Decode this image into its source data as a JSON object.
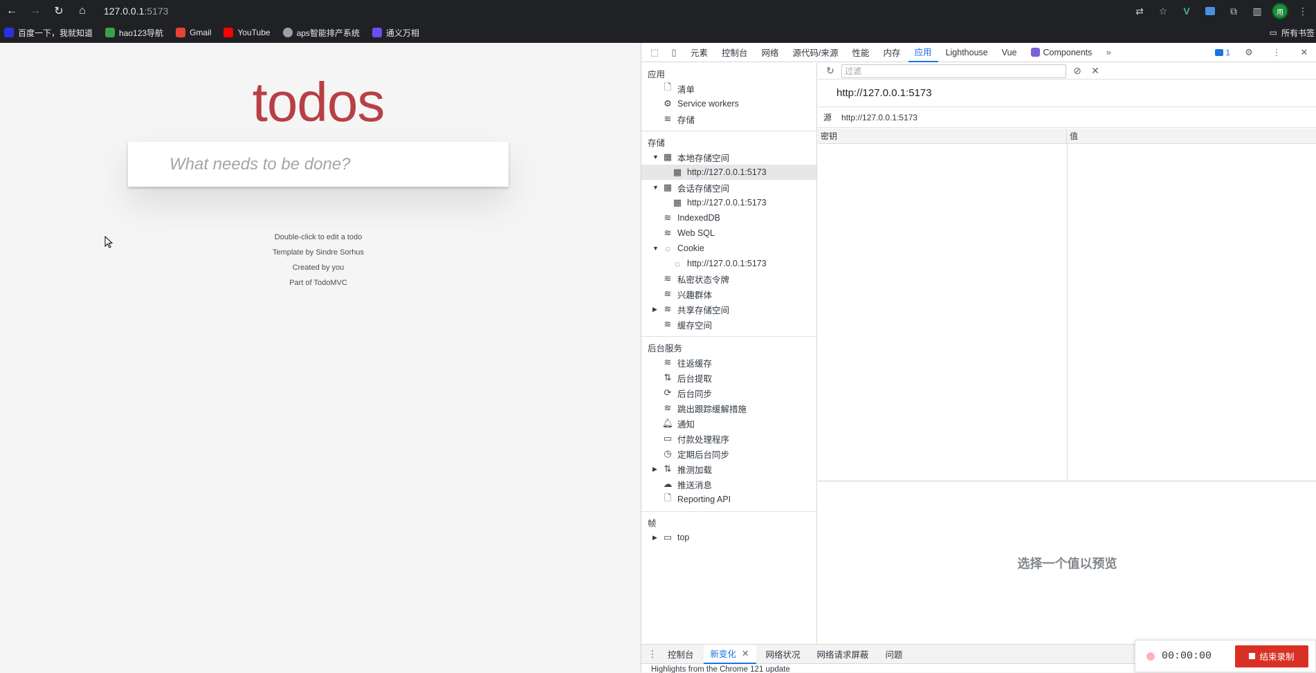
{
  "browser": {
    "url_host": "127.0.0.1",
    "url_port": ":5173",
    "avatar_text": "用",
    "bookmarks": [
      {
        "label": "百度一下，我就知道",
        "color": "#2932e1"
      },
      {
        "label": "hao123导航",
        "color": "#3aa04a"
      },
      {
        "label": "Gmail",
        "color": "#ea4335"
      },
      {
        "label": "YouTube",
        "color": "#ff0000"
      },
      {
        "label": "aps智能排产系统",
        "color": "#9aa0a6"
      },
      {
        "label": "通义万相",
        "color": "#6b4cf5"
      }
    ],
    "all_bookmarks": "所有书签"
  },
  "page": {
    "title": "todos",
    "new_todo_placeholder": "What needs to be done?",
    "info": [
      "Double-click to edit a todo",
      "Template by Sindre Sorhus",
      "Created by you",
      "Part of TodoMVC"
    ]
  },
  "devtools": {
    "tabs": [
      "元素",
      "控制台",
      "网络",
      "源代码/来源",
      "性能",
      "内存",
      "应用",
      "Lighthouse",
      "Vue",
      "Components"
    ],
    "active_tab": "应用",
    "issues_count": "1",
    "sidebar": {
      "app_head": "应用",
      "app_items": [
        "清单",
        "Service workers",
        "存储"
      ],
      "storage_head": "存储",
      "local_storage": "本地存储空间",
      "local_storage_origin": "http://127.0.0.1:5173",
      "session_storage": "会话存储空间",
      "session_storage_origin": "http://127.0.0.1:5173",
      "indexeddb": "IndexedDB",
      "websql": "Web SQL",
      "cookie": "Cookie",
      "cookie_origin": "http://127.0.0.1:5173",
      "private_state_tokens": "私密状态令牌",
      "interest_groups": "兴趣群体",
      "shared_storage": "共享存储空间",
      "cache_storage": "缓存空间",
      "bg_head": "后台服务",
      "bg_items": [
        "往返缓存",
        "后台提取",
        "后台同步",
        "跳出跟踪缓解措施",
        "通知",
        "付款处理程序",
        "定期后台同步",
        "推测加载",
        "推送消息",
        "Reporting API"
      ],
      "frames_head": "帧",
      "frame_top": "top"
    },
    "main": {
      "filter_placeholder": "过滤",
      "origin_title": "http://127.0.0.1:5173",
      "origin_label": "源",
      "origin_value": "http://127.0.0.1:5173",
      "col_key": "密钥",
      "col_value": "值",
      "preview_hint": "选择一个值以预览"
    },
    "drawer": {
      "tabs": [
        "控制台",
        "新变化",
        "网络状况",
        "网络请求屏蔽",
        "问题"
      ],
      "active_tab": "新变化",
      "message": "Highlights from the Chrome 121 update"
    }
  },
  "recorder": {
    "time": "00:00:00",
    "stop_label": "结束录制"
  },
  "colors": {
    "todos_title": "#b83f45",
    "accent": "#1a73e8",
    "stop_button": "#d93025"
  }
}
